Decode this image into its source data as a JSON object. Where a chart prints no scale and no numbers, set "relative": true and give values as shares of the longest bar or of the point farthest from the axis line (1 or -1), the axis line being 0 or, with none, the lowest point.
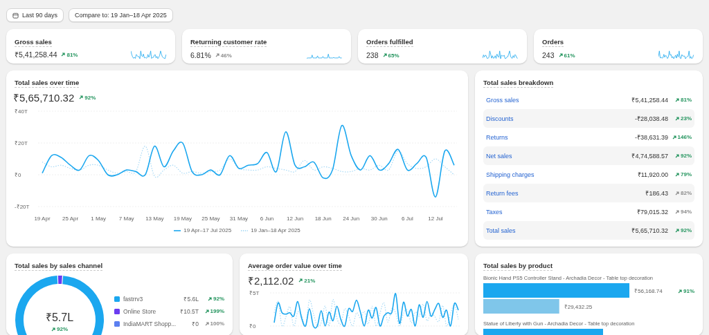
{
  "filters": [
    {
      "kind": "date",
      "label": "Last 90 days"
    },
    {
      "kind": "compare",
      "label": "Compare to: 19 Jan–18 Apr 2025"
    }
  ],
  "kpis": [
    {
      "title": "Gross sales",
      "value": "₹5,41,258.44",
      "delta": {
        "text": "81%",
        "positive": true
      }
    },
    {
      "title": "Returning customer rate",
      "value": "6.81%",
      "delta": {
        "text": "46%",
        "positive": false
      }
    },
    {
      "title": "Orders fulfilled",
      "value": "238",
      "delta": {
        "text": "65%",
        "positive": true
      }
    },
    {
      "title": "Orders",
      "value": "243",
      "delta": {
        "text": "61%",
        "positive": true
      }
    }
  ],
  "sales_over_time": {
    "title": "Total sales over time",
    "value": "₹5,65,710.32",
    "delta": {
      "text": "92%",
      "positive": true
    },
    "chart_data": {
      "type": "line",
      "ylim": [
        -20,
        40
      ],
      "categories": [
        "19 Apr",
        null,
        null,
        "25 Apr",
        null,
        null,
        "1 May",
        null,
        null,
        "7 May",
        null,
        null,
        "13 May",
        null,
        null,
        "19 May",
        null,
        null,
        "25 May",
        null,
        null,
        "31 May",
        null,
        null,
        "6 Jun",
        null,
        null,
        "12 Jun",
        null,
        null,
        "18 Jun",
        null,
        null,
        "24 Jun",
        null,
        null,
        "30 Jun",
        null,
        null,
        "6 Jul",
        null,
        null,
        "12 Jul",
        null,
        null
      ],
      "yticks": [
        {
          "value": 40,
          "label": "₹40T"
        },
        {
          "value": 20,
          "label": "₹20T"
        },
        {
          "value": 0,
          "label": "₹0"
        },
        {
          "value": -20,
          "label": "-₹20T"
        }
      ],
      "series": [
        {
          "name": "19 Apr–17 Jul 2025",
          "color": "#1ba7ef",
          "line_style": "solid",
          "values": [
            1,
            12,
            11,
            6,
            3,
            12,
            9,
            0,
            0,
            3,
            2,
            0,
            18,
            5,
            15,
            20,
            2,
            0,
            3,
            0,
            12,
            4,
            6,
            7,
            14,
            2,
            27,
            6,
            5,
            8,
            -2,
            3,
            31,
            12,
            3,
            12,
            3,
            7,
            16,
            3,
            7,
            11,
            -14,
            15,
            6
          ]
        },
        {
          "name": "19 Jan–18 Apr 2025",
          "color": "#9fd6f5",
          "line_style": "dotted",
          "values": [
            8,
            5,
            6,
            4,
            3,
            6,
            6,
            3,
            1,
            2,
            2,
            18,
            -1,
            3,
            6,
            1,
            2,
            1,
            2,
            3,
            10,
            4,
            3,
            3,
            5,
            4,
            3,
            2,
            9,
            3,
            5,
            4,
            2,
            2,
            4,
            3,
            6,
            3,
            15,
            7,
            4,
            5,
            10,
            5,
            0
          ]
        }
      ]
    }
  },
  "breakdown": {
    "title": "Total sales breakdown",
    "rows": [
      {
        "label": "Gross sales",
        "value": "₹5,41,258.44",
        "delta": {
          "text": "81%",
          "positive": true
        }
      },
      {
        "label": "Discounts",
        "value": "-₹28,038.48",
        "delta": {
          "text": "23%",
          "positive": true
        }
      },
      {
        "label": "Returns",
        "value": "-₹38,631.39",
        "delta": {
          "text": "146%",
          "positive": true
        }
      },
      {
        "label": "Net sales",
        "value": "₹4,74,588.57",
        "delta": {
          "text": "92%",
          "positive": true
        }
      },
      {
        "label": "Shipping charges",
        "value": "₹11,920.00",
        "delta": {
          "text": "79%",
          "positive": true
        }
      },
      {
        "label": "Return fees",
        "value": "₹186.43",
        "delta": {
          "text": "82%",
          "positive": false
        }
      },
      {
        "label": "Taxes",
        "value": "₹79,015.32",
        "delta": {
          "text": "94%",
          "positive": false
        }
      },
      {
        "label": "Total sales",
        "value": "₹5,65,710.32",
        "delta": {
          "text": "92%",
          "positive": true
        }
      }
    ]
  },
  "sales_by_channel": {
    "title": "Total sales by sales channel",
    "total": "₹5.7L",
    "delta": {
      "text": "92%",
      "positive": true
    },
    "chart_data": {
      "type": "donut",
      "categories": [
        "fastrrv3",
        "Online Store",
        "IndiaMART Shopp..."
      ],
      "values": [
        98.2,
        1.8,
        0
      ]
    },
    "channels": [
      {
        "color": "#1ba7ef",
        "amount": "₹5.6L",
        "delta": {
          "text": "92%",
          "positive": true
        }
      },
      {
        "color": "#6b3cf0",
        "amount": "₹10.5T",
        "delta": {
          "text": "199%",
          "positive": true
        }
      },
      {
        "color": "#5b7ff0",
        "amount": "₹0",
        "delta": {
          "text": "100%",
          "positive": false
        }
      }
    ]
  },
  "average_order_value": {
    "title": "Average order value over time",
    "value": "₹2,112.02",
    "delta": {
      "text": "21%",
      "positive": true
    },
    "chart_data": {
      "type": "line",
      "ylim": [
        0,
        5
      ],
      "yticks": [
        {
          "value": 5,
          "label": "₹5T"
        },
        {
          "value": 0,
          "label": "₹0"
        }
      ],
      "series": [
        {
          "color": "#1ba7ef",
          "line_style": "solid",
          "values": [
            0.5,
            3.5,
            2,
            1.8,
            2,
            1.5,
            3.7,
            1.2,
            0,
            2.6,
            0,
            0,
            2.3,
            0,
            2.1,
            0.8,
            3,
            1,
            0,
            2.6,
            2.2,
            3.9,
            2.1,
            0,
            2.4,
            1.2,
            2.8,
            0,
            1.5,
            2,
            2,
            4.9,
            0.4,
            3.6,
            1.5,
            2.5,
            0,
            3.2,
            1.3,
            3.7,
            1.5,
            2.5,
            3.4,
            1.3,
            2.4,
            0,
            3.4,
            2.4
          ]
        },
        {
          "color": "#9fd6f5",
          "line_style": "dotted",
          "values": [
            2,
            3.7,
            0,
            1.4,
            2.9,
            0,
            2.1,
            1.6,
            0,
            3.9,
            1.9,
            0,
            0.5,
            3,
            0,
            4,
            1.2,
            0.3,
            2.6,
            1.5,
            0,
            2,
            1.2,
            2.2,
            0.3,
            3,
            0,
            1.9,
            3.5,
            0.6,
            2.6,
            2,
            0,
            1.9,
            2.4,
            0.5,
            2.1,
            1.5,
            3.3,
            0.8,
            2,
            1.4,
            0.7,
            3.1,
            0,
            1.9,
            3.2,
            1
          ]
        }
      ]
    }
  },
  "products": {
    "title": "Total sales by product",
    "chart_data": {
      "type": "bar",
      "orientation": "horizontal",
      "relative": true,
      "categories": [
        "Bionic Hand PS5 Controller Stand - Archadia Decor - Table top decoration",
        "Statue of Liberty with Gun - Archadia Decor - Table top decoration"
      ],
      "series": [
        {
          "color": "#1ba7ef",
          "values": [
            1,
            0.82
          ]
        },
        {
          "color": "#7fc6ea",
          "values": [
            0.52,
            null
          ]
        }
      ]
    },
    "items": [
      {
        "current_amount": "₹56,168.74",
        "previous_amount": "₹29,432.25",
        "delta": {
          "text": "91%",
          "positive": true
        }
      }
    ]
  }
}
